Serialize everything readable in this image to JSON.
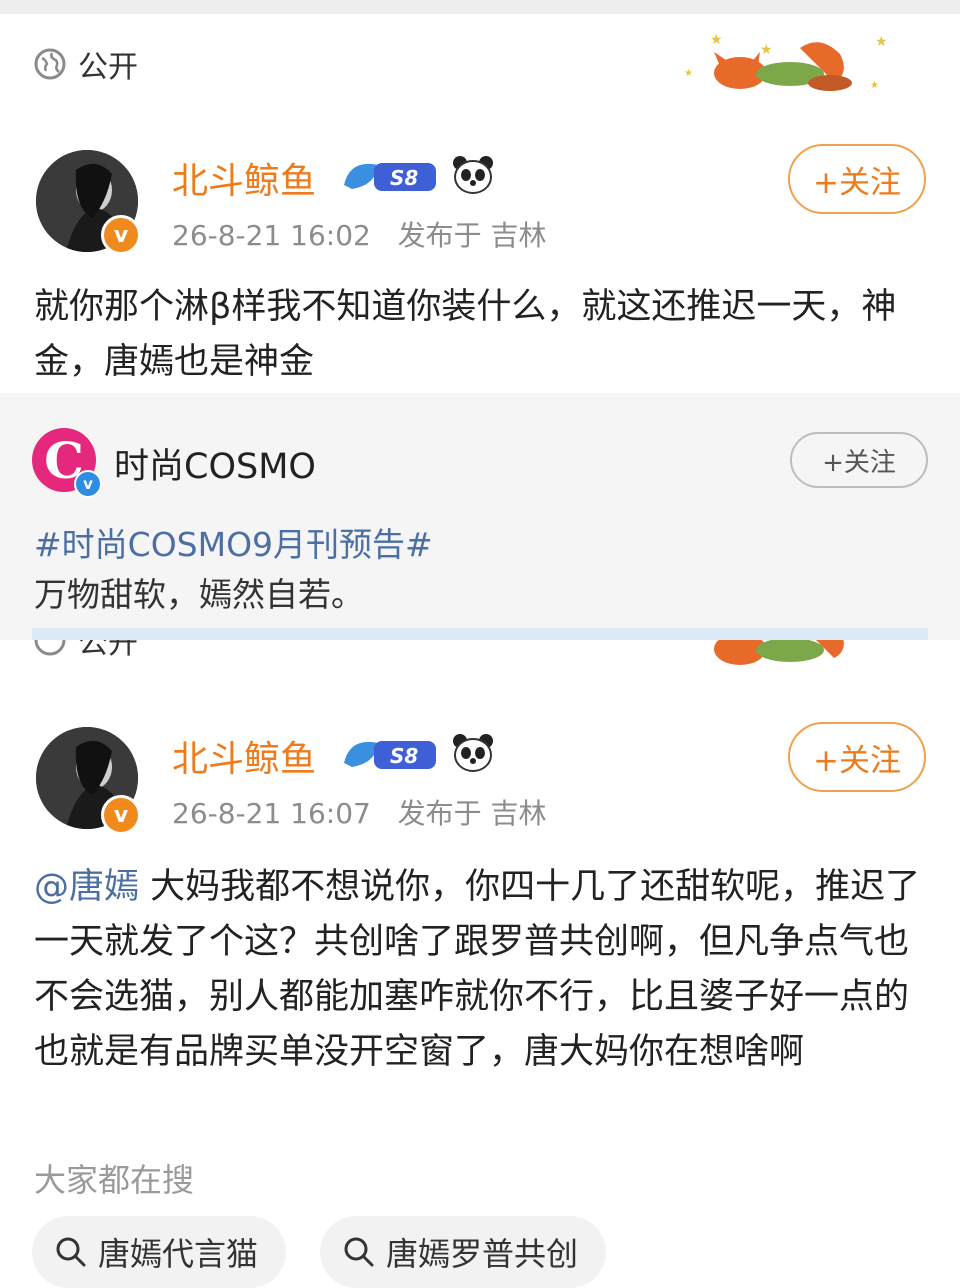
{
  "visibility": "公开",
  "posts": [
    {
      "username": "北斗鲸鱼",
      "level": "S8",
      "time": "26-8-21 16:02",
      "location": "发布于 吉林",
      "follow_label": "+关注",
      "text": "就你那个淋β样我不知道你装什么，就这还推迟一天，神金，唐嫣也是神金"
    },
    {
      "username": "北斗鲸鱼",
      "level": "S8",
      "time": "26-8-21 16:07",
      "location": "发布于 吉林",
      "follow_label": "+关注",
      "mention": "@唐嫣",
      "text": " 大妈我都不想说你，你四十几了还甜软呢，推迟了一天就发了个这？共创啥了跟罗普共创啊，但凡争点气也不会选猫，别人都能加塞咋就你不行，比且婆子好一点的也就是有品牌买单没开空窗了，唐大妈你在想啥啊"
    }
  ],
  "repost": {
    "account": "时尚COSMO",
    "logo_letter": "C",
    "follow_label": "+关注",
    "hashtag": "#时尚COSMO9月刊预告#",
    "text": "万物甜软，嫣然自若。"
  },
  "search": {
    "label": "大家都在搜",
    "chips": [
      "唐嫣代言猫",
      "唐嫣罗普共创"
    ]
  },
  "colors": {
    "username": "#ee7b1c",
    "link": "#4c6fa3",
    "repost_bg": "#f5f5f5"
  }
}
